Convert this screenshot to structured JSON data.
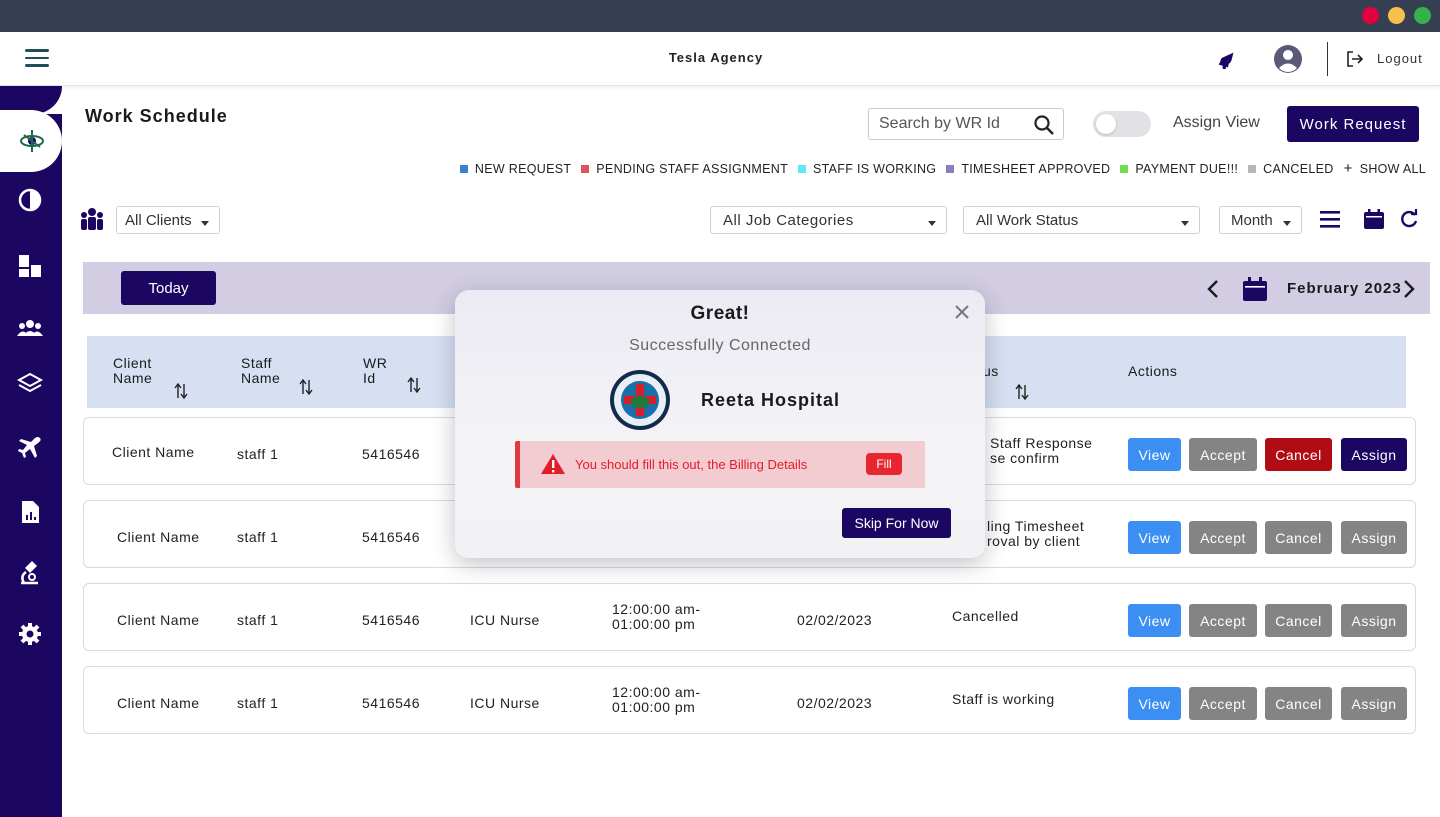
{
  "app": {
    "title": "Tesla Agency"
  },
  "header": {
    "logout_label": "Logout"
  },
  "page": {
    "title": "Work Schedule"
  },
  "search": {
    "placeholder": "Search by WR Id"
  },
  "assign_view_label": "Assign View",
  "work_request_label": "Work Request",
  "legend": [
    {
      "label": "NEW REQUEST",
      "color": "#3f7fc6"
    },
    {
      "label": "PENDING STAFF ASSIGNMENT",
      "color": "#e0525c"
    },
    {
      "label": "STAFF IS WORKING",
      "color": "#5ee8f4"
    },
    {
      "label": "TIMESHEET APPROVED",
      "color": "#8a7fc0"
    },
    {
      "label": "PAYMENT DUE!!!",
      "color": "#6fe04a"
    },
    {
      "label": "CANCELED",
      "color": "#b8b8b8"
    }
  ],
  "legend_show_all": "SHOW ALL",
  "filters": {
    "clients": "All Clients",
    "job_categories": "All Job Categories",
    "work_status": "All Work Status",
    "view_range": "Month"
  },
  "calendar": {
    "today_label": "Today",
    "month_label": "February 2023"
  },
  "table": {
    "headers": {
      "client_name_1": "Client",
      "client_name_2": "Name",
      "staff_name_1": "Staff",
      "staff_name_2": "Name",
      "wr_id_1": "WR",
      "wr_id_2": "Id",
      "status": "us",
      "actions": "Actions"
    },
    "rows": [
      {
        "client": "Client Name",
        "staff": "staff 1",
        "wr_id": "5416546",
        "job": "",
        "time_1": "",
        "time_2": "",
        "date": "",
        "status_1": "Staff Response",
        "status_2": "se confirm"
      },
      {
        "client": "Client Name",
        "staff": "staff 1",
        "wr_id": "5416546",
        "job": "",
        "time_1": "",
        "time_2": "",
        "date": "",
        "status_1": "ling Timesheet",
        "status_2": "roval by client"
      },
      {
        "client": "Client Name",
        "staff": "staff 1",
        "wr_id": "5416546",
        "job": "ICU Nurse",
        "time_1": "12:00:00 am-",
        "time_2": "01:00:00 pm",
        "date": "02/02/2023",
        "status_1": "Cancelled",
        "status_2": ""
      },
      {
        "client": "Client Name",
        "staff": "staff 1",
        "wr_id": "5416546",
        "job": "ICU Nurse",
        "time_1": "12:00:00 am-",
        "time_2": "01:00:00 pm",
        "date": "02/02/2023",
        "status_1": "Staff is working",
        "status_2": ""
      }
    ],
    "actions": {
      "view": "View",
      "accept": "Accept",
      "cancel": "Cancel",
      "assign": "Assign"
    }
  },
  "modal": {
    "title": "Great!",
    "subtitle": "Successfully Connected",
    "hospital_name": "Reeta Hospital",
    "alert_text": "You should fill this out, the Billing Details",
    "alert_button": "Fill",
    "skip_label": "Skip For Now"
  },
  "colors": {
    "brand": "#1b0762",
    "view_button": "#3c8ff2",
    "danger": "#b10c14",
    "neutral_button": "#848484",
    "header_band": "#d2cde2",
    "table_header": "#d7e0f3"
  }
}
